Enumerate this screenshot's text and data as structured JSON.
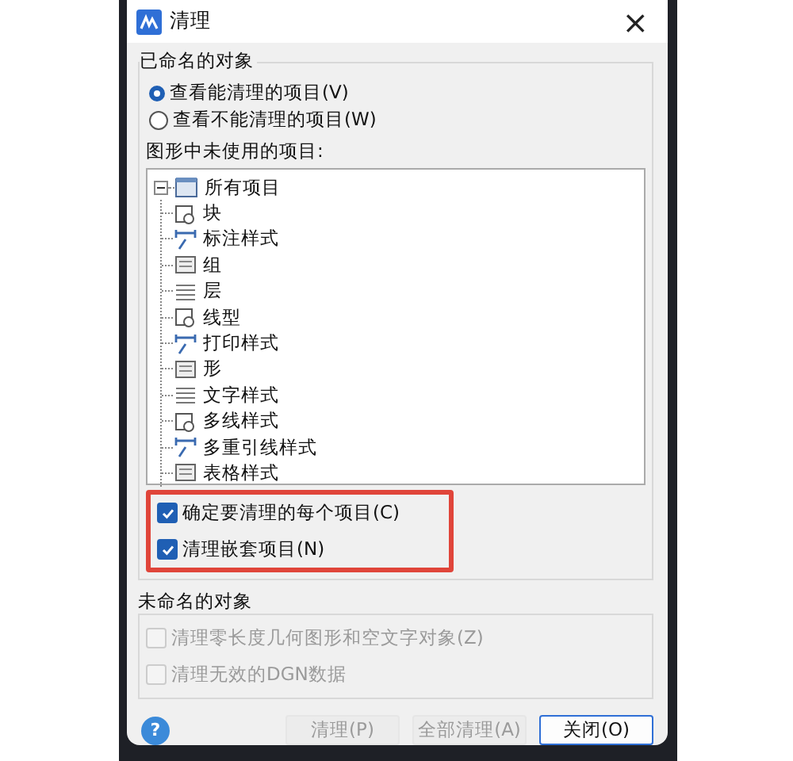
{
  "window": {
    "title": "清理",
    "close": "×"
  },
  "named_group": {
    "title": "已命名的对象",
    "options": [
      {
        "label": "查看能清理的项目(V)",
        "selected": true
      },
      {
        "label": "查看不能清理的项目(W)",
        "selected": false
      }
    ],
    "tree_label": "图形中未使用的项目:",
    "tree": {
      "label": "所有项目",
      "expanded": true,
      "children": [
        {
          "label": "块"
        },
        {
          "label": "标注样式"
        },
        {
          "label": "组"
        },
        {
          "label": "层"
        },
        {
          "label": "线型"
        },
        {
          "label": "打印样式"
        },
        {
          "label": "形"
        },
        {
          "label": "文字样式"
        },
        {
          "label": "多线样式"
        },
        {
          "label": "多重引线样式"
        },
        {
          "label": "表格样式"
        }
      ]
    },
    "checkboxes": [
      {
        "label": "确定要清理的每个项目(C)",
        "checked": true
      },
      {
        "label": "清理嵌套项目(N)",
        "checked": true
      }
    ]
  },
  "unnamed_group": {
    "title": "未命名的对象",
    "checkboxes": [
      {
        "label": "清理零长度几何图形和空文字对象(Z)",
        "checked": false,
        "disabled": true
      },
      {
        "label": "清理无效的DGN数据",
        "checked": false,
        "disabled": true
      }
    ]
  },
  "help": "?",
  "buttons": [
    {
      "label": "清理(P)",
      "disabled": true
    },
    {
      "label": "全部清理(A)",
      "disabled": true
    },
    {
      "label": "关闭(O)",
      "disabled": false
    }
  ]
}
